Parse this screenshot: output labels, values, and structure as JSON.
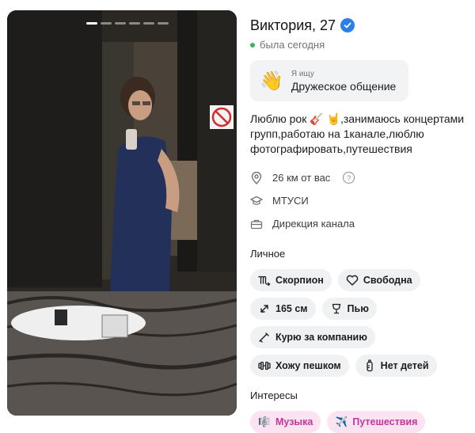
{
  "profile": {
    "name_age": "Виктория, 27",
    "status": "была сегодня",
    "seeking_label": "Я ищу",
    "seeking_value": "Дружеское общение",
    "about": "Люблю рок 🎸 🤘,занимаюсь концертами групп,работаю на 1канале,люблю фотографировать,путешествия",
    "distance": "26 км от вас",
    "education": "МТУСИ",
    "job": "Дирекция канала"
  },
  "personal": {
    "title": "Личное",
    "chips": [
      {
        "label": "Скорпион",
        "icon": "scorpio-icon"
      },
      {
        "label": "Свободна",
        "icon": "heart-icon"
      },
      {
        "label": "165 см",
        "icon": "height-icon"
      },
      {
        "label": "Пью",
        "icon": "glass-icon"
      },
      {
        "label": "Курю за компанию",
        "icon": "smoking-icon"
      },
      {
        "label": "Хожу пешком",
        "icon": "dumbbell-icon"
      },
      {
        "label": "Нет детей",
        "icon": "baby-bottle-icon"
      }
    ]
  },
  "interests": {
    "title": "Интересы",
    "chips": [
      {
        "label": "Музыка",
        "icon": "music-icon"
      },
      {
        "label": "Путешествия",
        "icon": "airplane-icon"
      }
    ]
  },
  "gallery": {
    "photo_count": 6,
    "active_photo_index": 0
  },
  "colors": {
    "accent": "#2c7ee8",
    "online": "#3ab55c",
    "interest_bg": "#fbe3f1",
    "interest_text": "#c3379a"
  }
}
